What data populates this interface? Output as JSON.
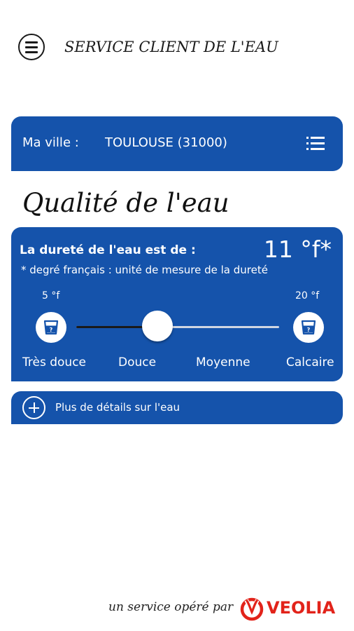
{
  "header": {
    "title": "SERVICE CLIENT DE L'EAU",
    "menu_icon": "hamburger-menu-icon"
  },
  "city": {
    "label": "Ma ville :",
    "value": "TOULOUSE (31000)",
    "list_icon": "list-icon"
  },
  "section_title": "Qualité de l'eau",
  "hardness": {
    "label": "La dureté de l'eau est de :",
    "value": "11 °f*",
    "note": "* degré français : unité de mesure de la dureté",
    "scale_min": "5 °f",
    "scale_max": "20 °f",
    "slider_fraction": 0.4,
    "levels": [
      "Très douce",
      "Douce",
      "Moyenne",
      "Calcaire"
    ],
    "left_icon": "glass-of-water-icon",
    "right_icon": "glass-of-water-icon"
  },
  "details": {
    "label": "Plus de détails sur l'eau",
    "icon": "plus-circle-icon"
  },
  "footer": {
    "text": "un service opéré par",
    "brand": "VEOLIA",
    "brand_color": "#e2231a"
  },
  "colors": {
    "primary": "#1553ab"
  }
}
